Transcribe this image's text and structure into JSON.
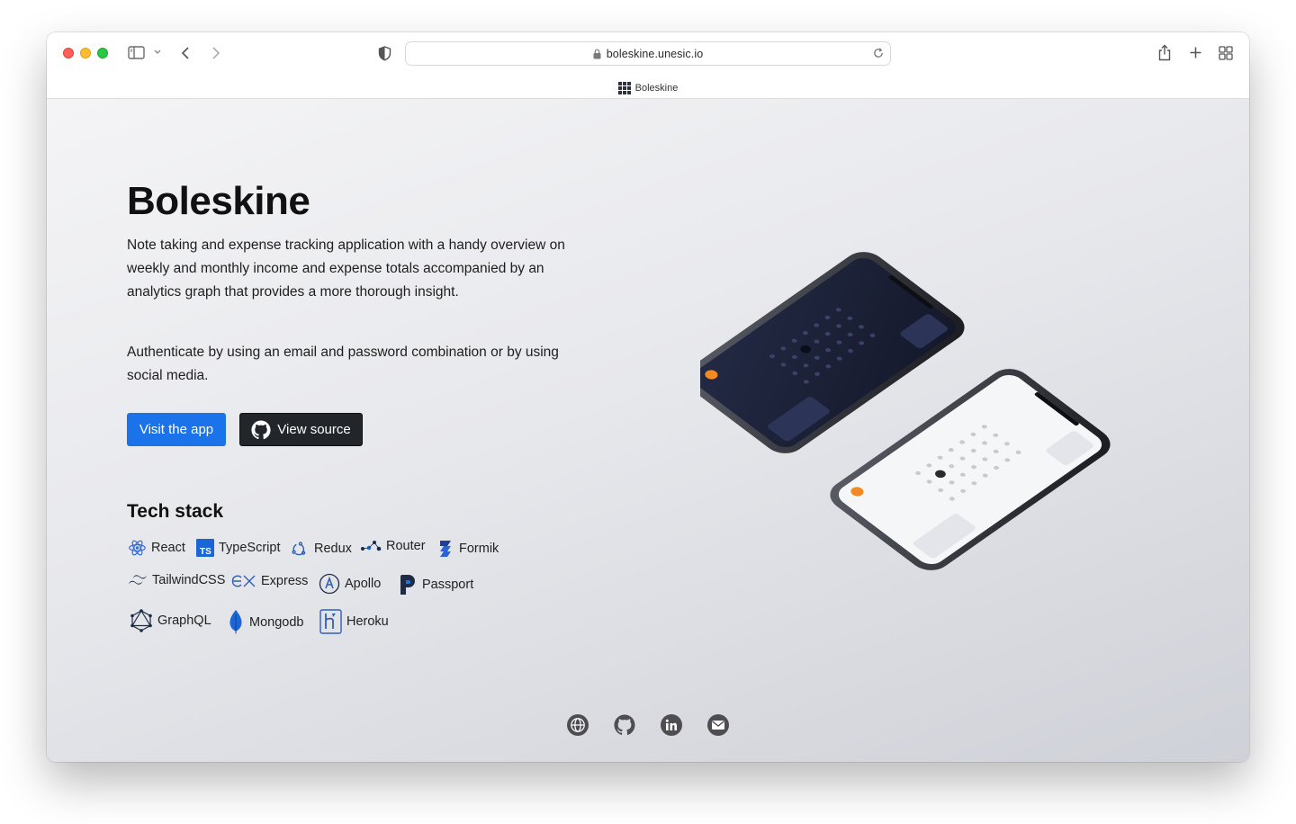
{
  "browser": {
    "url": "boleskine.unesic.io",
    "tab_title": "Boleskine"
  },
  "hero": {
    "title": "Boleskine",
    "description_1": "Note taking and expense tracking application with a handy overview on weekly and monthly income and expense totals accompanied by an analytics graph that provides a more thorough insight.",
    "description_2": "Authenticate by using an email and password combination or by using social media.",
    "visit_button": "Visit the app",
    "source_button": "View source"
  },
  "tech_stack": {
    "title": "Tech stack",
    "items": [
      "React",
      "TypeScript",
      "Redux",
      "Router",
      "Formik",
      "TailwindCSS",
      "Express",
      "Apollo",
      "Passport",
      "GraphQL",
      "Mongodb",
      "Heroku"
    ]
  },
  "footer": {
    "icons": [
      "globe-icon",
      "github-icon",
      "linkedin-icon",
      "mail-icon"
    ]
  },
  "colors": {
    "accent": "#1a73e8",
    "dark_button": "#22262a"
  }
}
